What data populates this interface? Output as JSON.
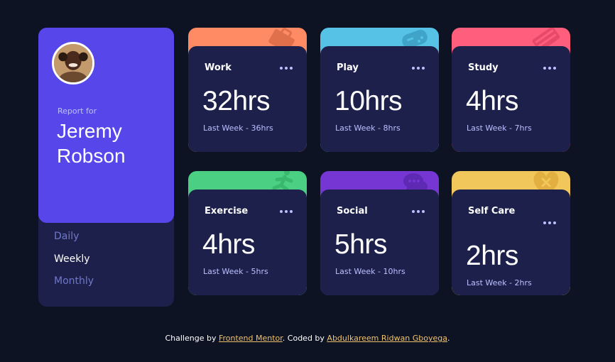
{
  "profile": {
    "report_for": "Report for",
    "name": "Jeremy Robson",
    "periods": [
      "Daily",
      "Weekly",
      "Monthly"
    ],
    "active_period": "Weekly"
  },
  "cards": [
    {
      "title": "Work",
      "current": "32hrs",
      "previous": "Last Week - 36hrs",
      "color": "#ff8b64",
      "icon": "briefcase-icon"
    },
    {
      "title": "Play",
      "current": "10hrs",
      "previous": "Last Week - 8hrs",
      "color": "#55c2e6",
      "icon": "gamepad-icon"
    },
    {
      "title": "Study",
      "current": "4hrs",
      "previous": "Last Week - 7hrs",
      "color": "#ff5e7d",
      "icon": "book-icon"
    },
    {
      "title": "Exercise",
      "current": "4hrs",
      "previous": "Last Week - 5hrs",
      "color": "#4bcf82",
      "icon": "running-icon"
    },
    {
      "title": "Social",
      "current": "5hrs",
      "previous": "Last Week - 10hrs",
      "color": "#7536d3",
      "icon": "social-icon"
    },
    {
      "title": "Self Care",
      "current": "2hrs",
      "previous": "Last Week - 2hrs",
      "color": "#f1c75b",
      "icon": "heart-icon"
    }
  ],
  "footer": {
    "prefix": "Challenge by",
    "link1": "Frontend Mentor",
    "middle": ". Coded by",
    "link2": "Abdulkareem Ridwan Gboyega",
    "suffix": "."
  },
  "colors": {
    "background": "#0e1323",
    "card": "#1c204b",
    "accent": "#5747ea",
    "link": "#f0c36b"
  }
}
